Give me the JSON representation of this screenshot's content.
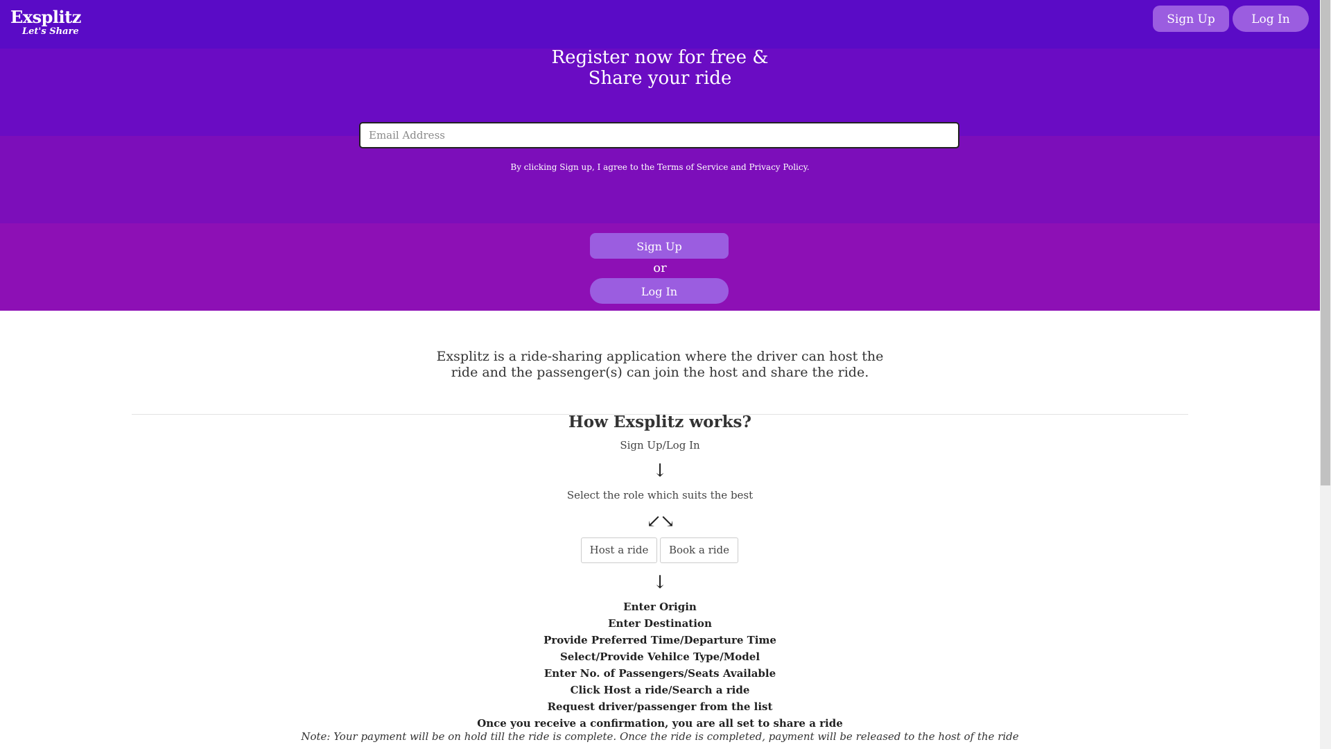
{
  "navbar": {
    "brand_name": "Exsplitz",
    "brand_tagline": "Let's Share",
    "signup_label": "Sign Up",
    "login_label": "Log In"
  },
  "hero": {
    "title_line1": "Register now for free &",
    "title_line2": "Share your ride",
    "email_placeholder": "Email Address",
    "terms_text": "By clicking Sign up, I agree to the Terms of Service and Privacy Policy.",
    "signup_label": "Sign Up",
    "or_text": "or",
    "login_label": "Log In",
    "colors": {
      "band_top": "#5a0bc6",
      "band_bottom": "#8d10b5",
      "button": "#9b5de0"
    }
  },
  "intro": {
    "line1": "Exsplitz is a ride-sharing application where the driver can host the",
    "line2": "ride and the passenger(s) can join the host and share the ride."
  },
  "how_it_works": {
    "title": "How Exsplitz works?",
    "step1": "Sign Up/Log In",
    "arrow_down": "↓",
    "step2": "Select the role which suits the best",
    "arrow_split": "↙↘",
    "role_host": "Host a ride",
    "role_book": "Book a ride",
    "details": [
      "Enter Origin",
      "Enter Destination",
      "Provide Preferred Time/Departure Time",
      "Select/Provide Vehilce Type/Model",
      "Enter No. of Passengers/Seats Available",
      "Click Host a ride/Search a ride",
      "Request driver/passenger from the list",
      "Once you receive a confirmation, you are all set to share a ride"
    ],
    "note": "Note: Your payment will be on hold till the ride is complete. Once the ride is completed, payment will be released to the host of the ride"
  }
}
